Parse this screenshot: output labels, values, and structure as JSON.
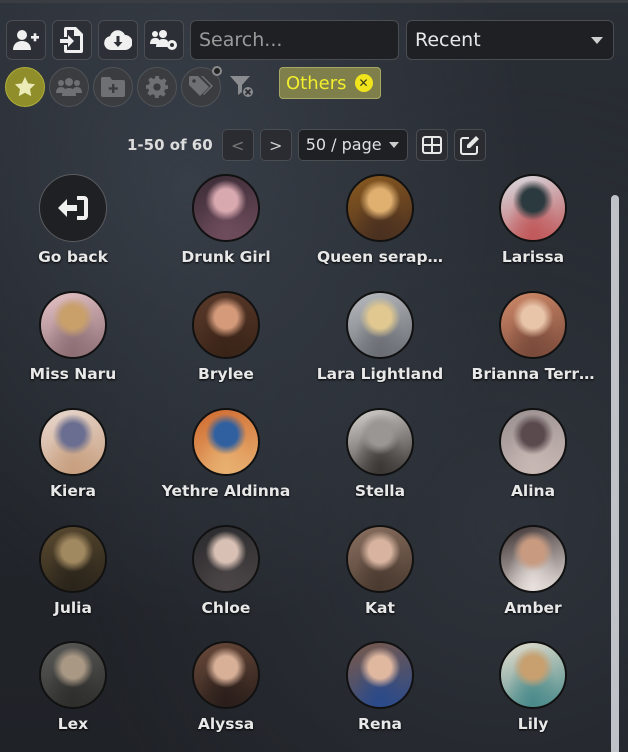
{
  "toolbar": {
    "buttons": [
      {
        "name": "create-character-button",
        "icon": "user-plus-icon"
      },
      {
        "name": "import-file-button",
        "icon": "file-import-icon"
      },
      {
        "name": "cloud-download-button",
        "icon": "cloud-download-icon"
      },
      {
        "name": "manage-group-button",
        "icon": "users-gear-icon"
      }
    ],
    "search_placeholder": "Search...",
    "sort_value": "Recent"
  },
  "filters": {
    "items": [
      {
        "name": "favorites-filter",
        "icon": "star-icon",
        "active": true
      },
      {
        "name": "groups-filter",
        "icon": "users-icon",
        "active": false
      },
      {
        "name": "folder-filter",
        "icon": "folder-plus-icon",
        "active": false
      },
      {
        "name": "settings-filter",
        "icon": "gear-icon",
        "active": false
      },
      {
        "name": "tags-filter",
        "icon": "tags-icon",
        "active": false
      }
    ],
    "tag_chip": "Others",
    "tag_remove": "✕"
  },
  "pager": {
    "count": "1-50 of 60",
    "prev": "<",
    "next": ">",
    "per_page": "50 / page"
  },
  "characters": [
    {
      "label": "Go back",
      "back": true
    },
    {
      "label": "Drunk Girl",
      "colors": [
        "#3a2b35",
        "#d9a9b0",
        "#6e4c5c"
      ]
    },
    {
      "label": "Queen serap…",
      "colors": [
        "#8a5a20",
        "#e0b070",
        "#4a3020"
      ]
    },
    {
      "label": "Larissa",
      "colors": [
        "#d8dde3",
        "#2a3a3e",
        "#c0585a"
      ]
    },
    {
      "label": "Miss Naru",
      "colors": [
        "#e6c4c8",
        "#c9a06a",
        "#8c6e74"
      ]
    },
    {
      "label": "Brylee",
      "colors": [
        "#5a3a2a",
        "#d49a7a",
        "#3a2418"
      ]
    },
    {
      "label": "Lara Lightland",
      "colors": [
        "#b8bcc0",
        "#e0c890",
        "#6a6e74"
      ]
    },
    {
      "label": "Brianna Terr…",
      "colors": [
        "#d08a6a",
        "#e8c4a8",
        "#7a4a3a"
      ]
    },
    {
      "label": "Kiera",
      "colors": [
        "#e8d8d0",
        "#6a6e90",
        "#c8a080"
      ]
    },
    {
      "label": "Yethre Aldinna",
      "colors": [
        "#d06a30",
        "#3060a0",
        "#e8b070"
      ]
    },
    {
      "label": "Stella",
      "colors": [
        "#d8d4d0",
        "#9a9694",
        "#3a3634"
      ]
    },
    {
      "label": "Alina",
      "colors": [
        "#9a9090",
        "#5a4a4e",
        "#c8b8b4"
      ]
    },
    {
      "label": "Julia",
      "colors": [
        "#5a4a30",
        "#a08860",
        "#2a241a"
      ]
    },
    {
      "label": "Chloe",
      "colors": [
        "#2a2a2c",
        "#d8c0b4",
        "#4a4446"
      ]
    },
    {
      "label": "Kat",
      "colors": [
        "#8a7060",
        "#d8b4a0",
        "#4a3a30"
      ]
    },
    {
      "label": "Amber",
      "colors": [
        "#3a3030",
        "#c89a80",
        "#e8e0dc"
      ]
    },
    {
      "label": "Lex",
      "colors": [
        "#5a5a58",
        "#a89884",
        "#2e2e2c"
      ]
    },
    {
      "label": "Alyssa",
      "colors": [
        "#6a4a3a",
        "#d8b098",
        "#2a1e1a"
      ]
    },
    {
      "label": "Rena",
      "colors": [
        "#7a5a4a",
        "#e0b8a0",
        "#2a4a8a"
      ]
    },
    {
      "label": "Lily",
      "colors": [
        "#e8e0d0",
        "#c8a070",
        "#4a8a8a"
      ]
    }
  ]
}
